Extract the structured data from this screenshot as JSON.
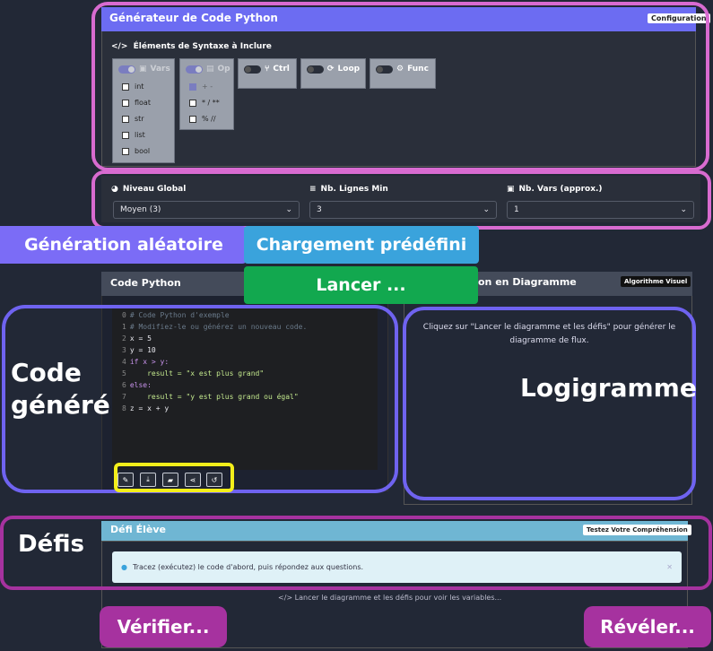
{
  "config": {
    "title": "Générateur de Code Python",
    "badge": "Configuration",
    "syntax_title": "Éléments de Syntaxe à Inclure",
    "groups": {
      "vars": {
        "label": "Vars",
        "items": [
          "int",
          "float",
          "str",
          "list",
          "bool"
        ]
      },
      "op": {
        "label": "Op",
        "items": [
          "+ -",
          "* / **",
          "% //"
        ]
      },
      "ctrl": {
        "label": "Ctrl"
      },
      "loop": {
        "label": "Loop"
      },
      "func": {
        "label": "Func"
      }
    }
  },
  "levels": {
    "global": {
      "label": "Niveau Global",
      "value": "Moyen (3)"
    },
    "lines": {
      "label": "Nb. Lignes Min",
      "value": "3"
    },
    "vars": {
      "label": "Nb. Vars (approx.)",
      "value": "1"
    }
  },
  "callouts": {
    "random": "Génération aléatoire",
    "preset": "Chargement prédéfini",
    "launch": "Lancer ...",
    "code": "Code\ngénéré",
    "flow": "Logigramme",
    "challenges": "Défis",
    "verify": "Vérifier...",
    "reveal": "Révéler..."
  },
  "code_panel": {
    "title": "Code Python",
    "lines": [
      {
        "n": "0",
        "text": "# Code Python d'exemple"
      },
      {
        "n": "1",
        "text": "# Modifiez-le ou générez un nouveau code."
      },
      {
        "n": "2",
        "text": "x = 5"
      },
      {
        "n": "3",
        "text": "y = 10"
      },
      {
        "n": "4",
        "text": "if x > y:"
      },
      {
        "n": "5",
        "text": "    result = \"x est plus grand\""
      },
      {
        "n": "6",
        "text": "else:"
      },
      {
        "n": "7",
        "text": "    result = \"y est plus grand ou égal\""
      },
      {
        "n": "8",
        "text": "z = x + y"
      }
    ]
  },
  "diagram": {
    "title": "on en Diagramme",
    "badge": "Algorithme Visuel",
    "message": "Cliquez sur \"Lancer le diagramme et les défis\" pour générer le diagramme de flux."
  },
  "challenge": {
    "title": "Défi Élève",
    "badge": "Testez Votre Compréhension",
    "alert": "Tracez (exécutez) le code d'abord, puis répondez aux questions.",
    "footer": "Lancer le diagramme et les défis pour voir les variables..."
  },
  "colors": {
    "violet": "#7b6cf6",
    "blue": "#3aa3dc",
    "green": "#12a84f",
    "magenta": "#a6329f",
    "pink": "#d86bd0",
    "yellow": "#f3ee1a"
  }
}
